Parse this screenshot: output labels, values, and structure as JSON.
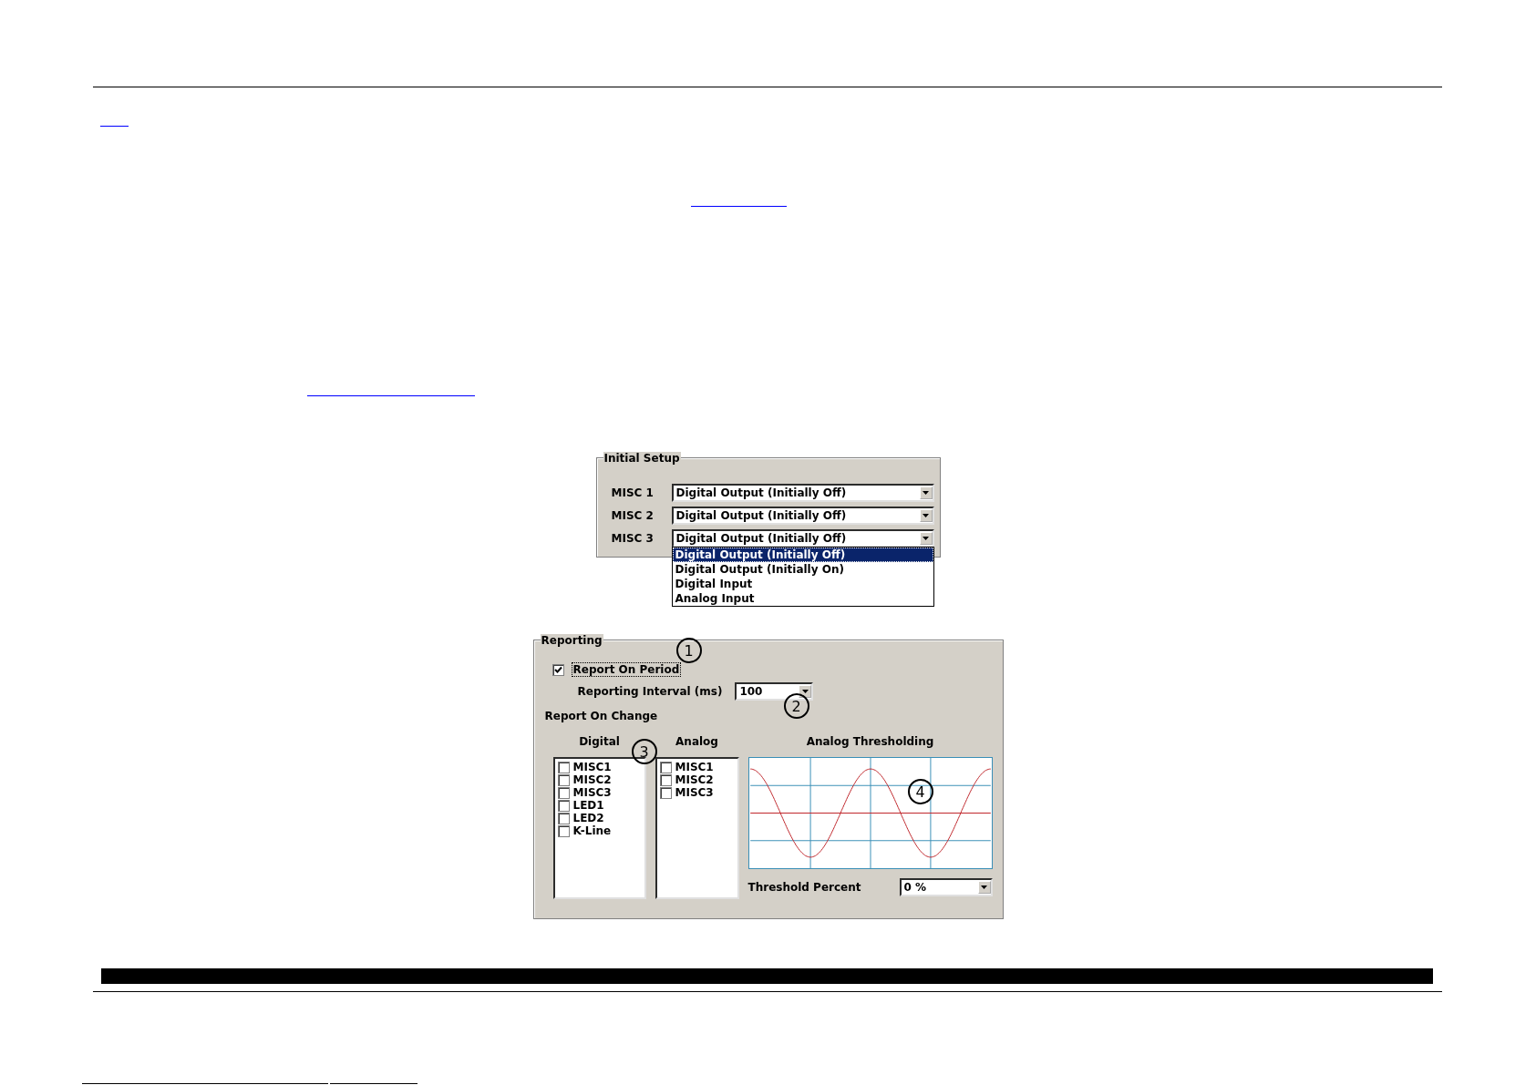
{
  "initial_setup": {
    "title": "Initial Setup",
    "rows": [
      {
        "label": "MISC 1",
        "value": "Digital Output (Initially Off)",
        "expanded": false
      },
      {
        "label": "MISC 2",
        "value": "Digital Output (Initially Off)",
        "expanded": false
      },
      {
        "label": "MISC 3",
        "value": "Digital Output (Initially Off)",
        "expanded": true
      }
    ],
    "options": [
      {
        "label": "Digital Output (Initially Off)",
        "selected": true
      },
      {
        "label": "Digital Output (Initially On)",
        "selected": false
      },
      {
        "label": "Digital Input",
        "selected": false
      },
      {
        "label": "Analog Input",
        "selected": false
      }
    ]
  },
  "reporting": {
    "title": "Reporting",
    "report_on_period": {
      "label": "Report On Period",
      "checked": true
    },
    "interval": {
      "label": "Reporting Interval (ms)",
      "value": "100"
    },
    "report_on_change": "Report On Change",
    "digital": {
      "heading": "Digital",
      "items": [
        {
          "label": "MISC1",
          "checked": false
        },
        {
          "label": "MISC2",
          "checked": false
        },
        {
          "label": "MISC3",
          "checked": false
        },
        {
          "label": "LED1",
          "checked": false
        },
        {
          "label": "LED2",
          "checked": false
        },
        {
          "label": "K-Line",
          "checked": false
        }
      ]
    },
    "analog": {
      "heading": "Analog",
      "items": [
        {
          "label": "MISC1",
          "checked": false
        },
        {
          "label": "MISC2",
          "checked": false
        },
        {
          "label": "MISC3",
          "checked": false
        }
      ]
    },
    "thresholding": {
      "heading": "Analog Thresholding"
    },
    "threshold": {
      "label": "Threshold Percent",
      "value": "0 %"
    }
  },
  "callouts": [
    "1",
    "2",
    "3",
    "4"
  ]
}
